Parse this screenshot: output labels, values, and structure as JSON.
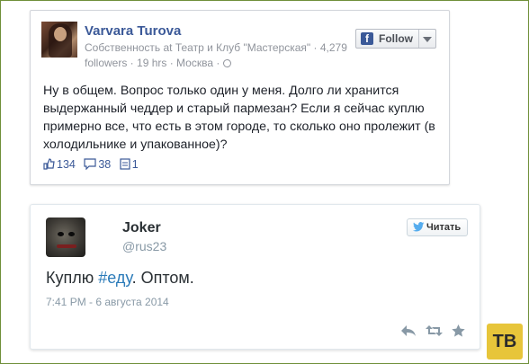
{
  "facebook_post": {
    "author": "Varvara Turova",
    "meta_prefix": "Собственность at ",
    "meta_link": "Театр и Клуб \"Мастерская\"",
    "meta_suffix": " · 4,279 followers · 19 hrs · Москва · ",
    "follow_label": "Follow",
    "body": "Ну в общем. Вопрос только один у меня. Долго ли хранится выдержанный чеддер и старый пармезан? Если я сейчас куплю примерно все, что есть в этом городе, то сколько оно пролежит (в холодильнике и упакованное)?",
    "likes": "134",
    "comments": "38",
    "shares": "1",
    "colors": {
      "link": "#3b5998",
      "text": "#1d2129",
      "meta": "#90949c"
    }
  },
  "tweet": {
    "name": "Joker",
    "handle": "@rus23",
    "follow_label": "Читать",
    "text_before": "Куплю ",
    "hashtag": "#еду",
    "text_after": ". Оптом.",
    "timestamp": "7:41 PM - 6 августа 2014",
    "actions": [
      "reply-icon",
      "retweet-icon",
      "favorite-icon"
    ],
    "colors": {
      "hashtag": "#2b7bb9",
      "secondary": "#8899a6"
    }
  },
  "watermark": {
    "text": "ТВ",
    "color": "#e7c53a"
  }
}
